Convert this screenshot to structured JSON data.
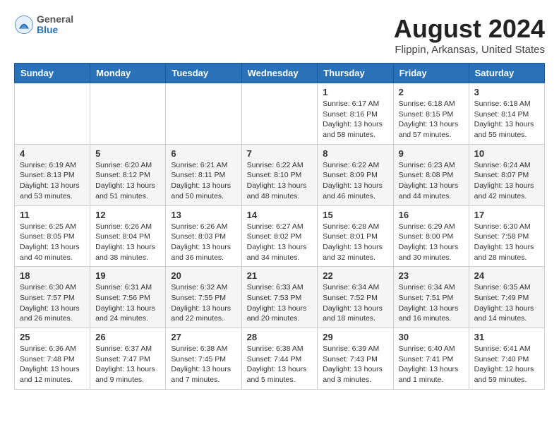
{
  "header": {
    "logo_line1": "General",
    "logo_line2": "Blue",
    "title": "August 2024",
    "subtitle": "Flippin, Arkansas, United States"
  },
  "weekdays": [
    "Sunday",
    "Monday",
    "Tuesday",
    "Wednesday",
    "Thursday",
    "Friday",
    "Saturday"
  ],
  "weeks": [
    [
      {
        "day": "",
        "info": ""
      },
      {
        "day": "",
        "info": ""
      },
      {
        "day": "",
        "info": ""
      },
      {
        "day": "",
        "info": ""
      },
      {
        "day": "1",
        "info": "Sunrise: 6:17 AM\nSunset: 8:16 PM\nDaylight: 13 hours\nand 58 minutes."
      },
      {
        "day": "2",
        "info": "Sunrise: 6:18 AM\nSunset: 8:15 PM\nDaylight: 13 hours\nand 57 minutes."
      },
      {
        "day": "3",
        "info": "Sunrise: 6:18 AM\nSunset: 8:14 PM\nDaylight: 13 hours\nand 55 minutes."
      }
    ],
    [
      {
        "day": "4",
        "info": "Sunrise: 6:19 AM\nSunset: 8:13 PM\nDaylight: 13 hours\nand 53 minutes."
      },
      {
        "day": "5",
        "info": "Sunrise: 6:20 AM\nSunset: 8:12 PM\nDaylight: 13 hours\nand 51 minutes."
      },
      {
        "day": "6",
        "info": "Sunrise: 6:21 AM\nSunset: 8:11 PM\nDaylight: 13 hours\nand 50 minutes."
      },
      {
        "day": "7",
        "info": "Sunrise: 6:22 AM\nSunset: 8:10 PM\nDaylight: 13 hours\nand 48 minutes."
      },
      {
        "day": "8",
        "info": "Sunrise: 6:22 AM\nSunset: 8:09 PM\nDaylight: 13 hours\nand 46 minutes."
      },
      {
        "day": "9",
        "info": "Sunrise: 6:23 AM\nSunset: 8:08 PM\nDaylight: 13 hours\nand 44 minutes."
      },
      {
        "day": "10",
        "info": "Sunrise: 6:24 AM\nSunset: 8:07 PM\nDaylight: 13 hours\nand 42 minutes."
      }
    ],
    [
      {
        "day": "11",
        "info": "Sunrise: 6:25 AM\nSunset: 8:05 PM\nDaylight: 13 hours\nand 40 minutes."
      },
      {
        "day": "12",
        "info": "Sunrise: 6:26 AM\nSunset: 8:04 PM\nDaylight: 13 hours\nand 38 minutes."
      },
      {
        "day": "13",
        "info": "Sunrise: 6:26 AM\nSunset: 8:03 PM\nDaylight: 13 hours\nand 36 minutes."
      },
      {
        "day": "14",
        "info": "Sunrise: 6:27 AM\nSunset: 8:02 PM\nDaylight: 13 hours\nand 34 minutes."
      },
      {
        "day": "15",
        "info": "Sunrise: 6:28 AM\nSunset: 8:01 PM\nDaylight: 13 hours\nand 32 minutes."
      },
      {
        "day": "16",
        "info": "Sunrise: 6:29 AM\nSunset: 8:00 PM\nDaylight: 13 hours\nand 30 minutes."
      },
      {
        "day": "17",
        "info": "Sunrise: 6:30 AM\nSunset: 7:58 PM\nDaylight: 13 hours\nand 28 minutes."
      }
    ],
    [
      {
        "day": "18",
        "info": "Sunrise: 6:30 AM\nSunset: 7:57 PM\nDaylight: 13 hours\nand 26 minutes."
      },
      {
        "day": "19",
        "info": "Sunrise: 6:31 AM\nSunset: 7:56 PM\nDaylight: 13 hours\nand 24 minutes."
      },
      {
        "day": "20",
        "info": "Sunrise: 6:32 AM\nSunset: 7:55 PM\nDaylight: 13 hours\nand 22 minutes."
      },
      {
        "day": "21",
        "info": "Sunrise: 6:33 AM\nSunset: 7:53 PM\nDaylight: 13 hours\nand 20 minutes."
      },
      {
        "day": "22",
        "info": "Sunrise: 6:34 AM\nSunset: 7:52 PM\nDaylight: 13 hours\nand 18 minutes."
      },
      {
        "day": "23",
        "info": "Sunrise: 6:34 AM\nSunset: 7:51 PM\nDaylight: 13 hours\nand 16 minutes."
      },
      {
        "day": "24",
        "info": "Sunrise: 6:35 AM\nSunset: 7:49 PM\nDaylight: 13 hours\nand 14 minutes."
      }
    ],
    [
      {
        "day": "25",
        "info": "Sunrise: 6:36 AM\nSunset: 7:48 PM\nDaylight: 13 hours\nand 12 minutes."
      },
      {
        "day": "26",
        "info": "Sunrise: 6:37 AM\nSunset: 7:47 PM\nDaylight: 13 hours\nand 9 minutes."
      },
      {
        "day": "27",
        "info": "Sunrise: 6:38 AM\nSunset: 7:45 PM\nDaylight: 13 hours\nand 7 minutes."
      },
      {
        "day": "28",
        "info": "Sunrise: 6:38 AM\nSunset: 7:44 PM\nDaylight: 13 hours\nand 5 minutes."
      },
      {
        "day": "29",
        "info": "Sunrise: 6:39 AM\nSunset: 7:43 PM\nDaylight: 13 hours\nand 3 minutes."
      },
      {
        "day": "30",
        "info": "Sunrise: 6:40 AM\nSunset: 7:41 PM\nDaylight: 13 hours\nand 1 minute."
      },
      {
        "day": "31",
        "info": "Sunrise: 6:41 AM\nSunset: 7:40 PM\nDaylight: 12 hours\nand 59 minutes."
      }
    ]
  ]
}
